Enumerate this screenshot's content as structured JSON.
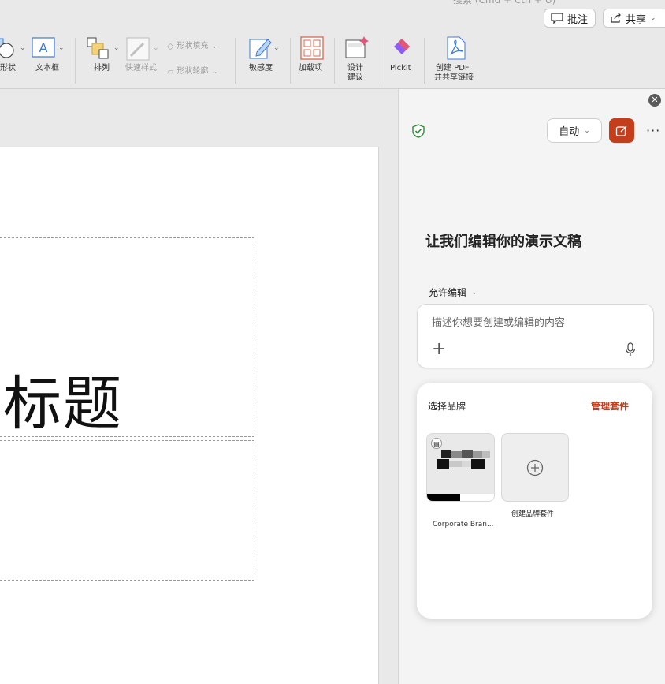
{
  "topbar": {
    "search_hint": "搜索 (Cmd + Ctrl + U)",
    "comments_label": "批注",
    "share_label": "共享"
  },
  "ribbon": {
    "shape_label": "形状",
    "textbox_label": "文本框",
    "arrange_label": "排列",
    "quick_styles_label": "快速样式",
    "shape_fill_label": "形状填充",
    "shape_outline_label": "形状轮廓",
    "sensitivity_label": "敏感度",
    "addins_label": "加载项",
    "designer_label_1": "设计",
    "designer_label_2": "建议",
    "pickit_label": "Pickit",
    "pdf_label_1": "创建 PDF",
    "pdf_label_2": "并共享链接"
  },
  "slide": {
    "title_text": "标题"
  },
  "pane": {
    "auto_label": "自动",
    "heading": "让我们编辑你的演示文稿",
    "allow_edit_label": "允许编辑",
    "prompt_placeholder": "描述你想要创建或编辑的内容",
    "brand_section_title": "选择品牌",
    "manage_kits_label": "管理套件",
    "kit1_label": "Corporate Bran...",
    "kit2_label": "创建品牌套件"
  },
  "colors": {
    "accent_orange": "#c43e1c",
    "shield_green": "#2e8b3a",
    "designer_pink": "#e0577a",
    "pickit_purple": "#8b5cf6"
  }
}
